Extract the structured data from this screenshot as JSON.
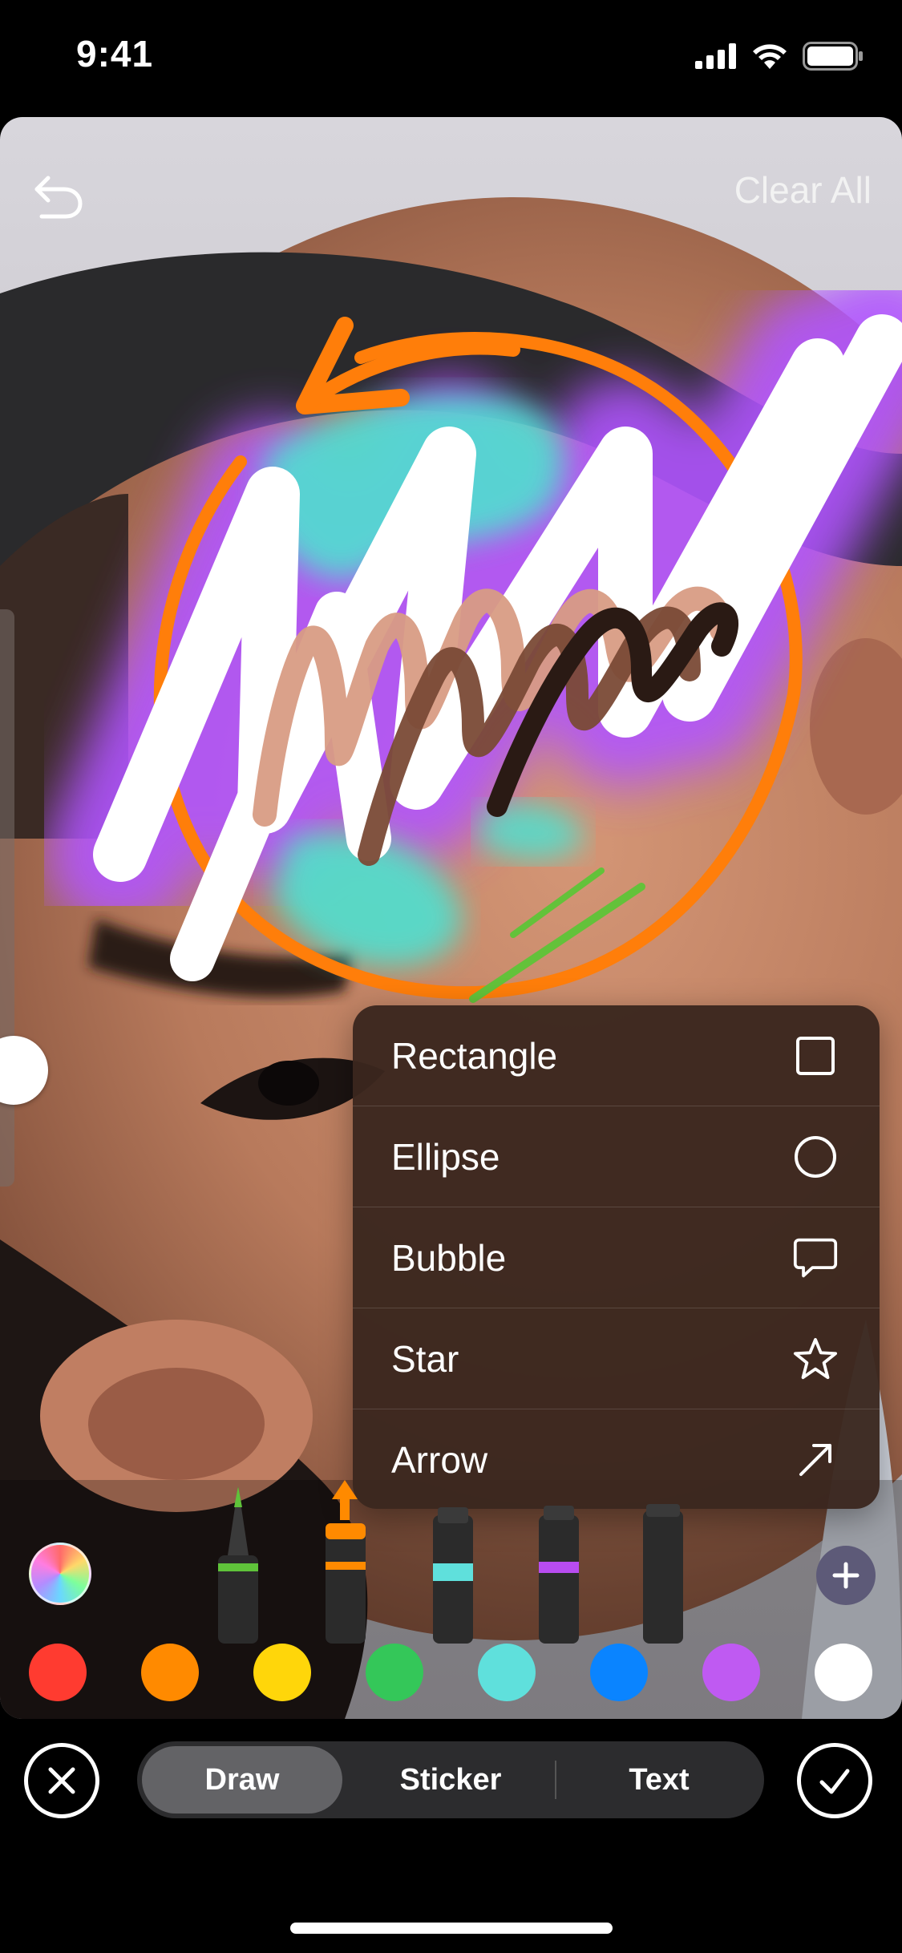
{
  "status_bar": {
    "time": "9:41",
    "icons": [
      "signal-icon",
      "wifi-icon",
      "battery-icon"
    ]
  },
  "header": {
    "undo_icon": "undo-icon",
    "clear_all_label": "Clear All"
  },
  "shape_menu": {
    "items": [
      {
        "label": "Rectangle",
        "icon": "rectangle-icon"
      },
      {
        "label": "Ellipse",
        "icon": "ellipse-icon"
      },
      {
        "label": "Bubble",
        "icon": "bubble-icon"
      },
      {
        "label": "Star",
        "icon": "star-icon"
      },
      {
        "label": "Arrow",
        "icon": "arrow-icon"
      }
    ]
  },
  "tools": {
    "brushes": [
      "pen",
      "marker",
      "highlighter",
      "crayon",
      "pencil"
    ],
    "brush_colors": [
      "#5fc33a",
      "#ff8a00",
      "#5fe0dc",
      "#b84cf0",
      "#3a3a3a"
    ],
    "selected_brush": "marker"
  },
  "palette": {
    "colors": [
      "#ff3b30",
      "#ff8a00",
      "#ffd60a",
      "#34c759",
      "#5fe0dc",
      "#0a84ff",
      "#bf5af2",
      "#ffffff"
    ]
  },
  "bottom_bar": {
    "cancel_icon": "close-icon",
    "confirm_icon": "checkmark-icon",
    "tabs": [
      {
        "label": "Draw",
        "active": true
      },
      {
        "label": "Sticker",
        "active": false
      },
      {
        "label": "Text",
        "active": false
      }
    ]
  }
}
